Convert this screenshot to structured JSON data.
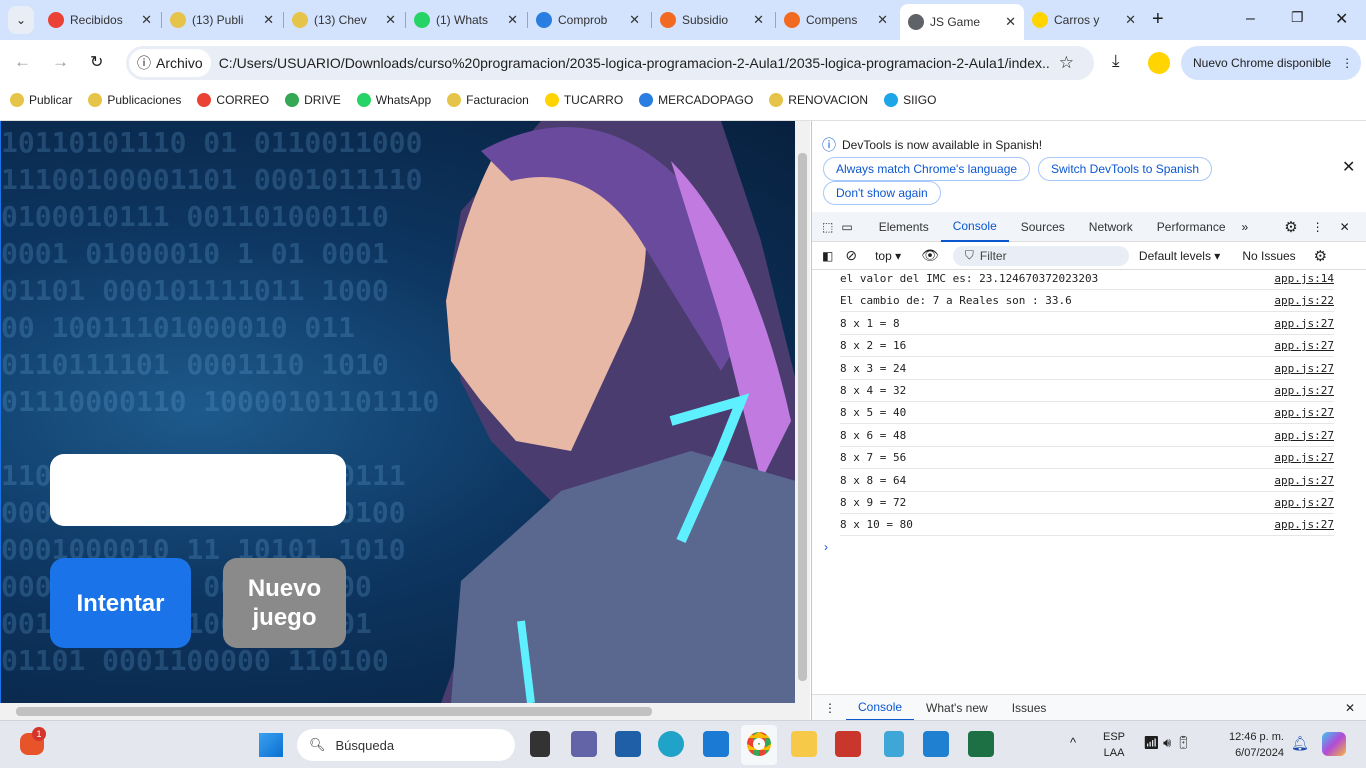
{
  "tabs": [
    {
      "label": "Recibidos",
      "color": "#ea4335"
    },
    {
      "label": "(13) Publi",
      "color": "#e6c44a"
    },
    {
      "label": "(13) Chev",
      "color": "#e6c44a"
    },
    {
      "label": "(1) Whats",
      "color": "#25d366"
    },
    {
      "label": "Comprob",
      "color": "#2a7de1"
    },
    {
      "label": "Subsidio",
      "color": "#f26a21"
    },
    {
      "label": "Compens",
      "color": "#f26a21"
    },
    {
      "label": "JS Game",
      "color": "#5f6368"
    },
    {
      "label": "Carros y",
      "color": "#ffd400"
    }
  ],
  "active_tab": 7,
  "address": {
    "chip": "Archivo",
    "url": "C:/Users/USUARIO/Downloads/curso%20programacion/2035-logica-programacion-2-Aula1/2035-logica-programacion-2-Aula1/index..."
  },
  "update_button": "Nuevo Chrome disponible",
  "bookmarks": [
    {
      "label": "Publicar",
      "color": "#e6c44a"
    },
    {
      "label": "Publicaciones",
      "color": "#e6c44a"
    },
    {
      "label": "CORREO",
      "color": "#ea4335"
    },
    {
      "label": "DRIVE",
      "color": "#34a853"
    },
    {
      "label": "WhatsApp",
      "color": "#25d366"
    },
    {
      "label": "Facturacion",
      "color": "#e6c44a"
    },
    {
      "label": "TUCARRO",
      "color": "#ffd400"
    },
    {
      "label": "MERCADOPAGO",
      "color": "#2a7de1"
    },
    {
      "label": "RENOVACION",
      "color": "#e6c44a"
    },
    {
      "label": "SIIGO",
      "color": "#1ea5e8"
    }
  ],
  "game": {
    "input_value": "",
    "try_button": "Intentar",
    "new_game_button": "Nuevo juego",
    "try_color": "#1a73e8",
    "new_color": "#8a8a8a"
  },
  "devtools": {
    "banner": "DevTools is now available in Spanish!",
    "pills": [
      "Always match Chrome's language",
      "Switch DevTools to Spanish",
      "Don't show again"
    ],
    "tabs": [
      "Elements",
      "Console",
      "Sources",
      "Network",
      "Performance"
    ],
    "active_tab": "Console",
    "context": "top",
    "filter_placeholder": "Filter",
    "levels": "Default levels",
    "issues": "No Issues",
    "logs": [
      {
        "msg": "el valor del IMC es: 23.124670372023203",
        "src": "app.js:14"
      },
      {
        "msg": "El cambio de: 7 a Reales son : 33.6",
        "src": "app.js:22"
      },
      {
        "msg": "8 x 1 = 8",
        "src": "app.js:27"
      },
      {
        "msg": "8 x 2 = 16",
        "src": "app.js:27"
      },
      {
        "msg": "8 x 3 = 24",
        "src": "app.js:27"
      },
      {
        "msg": "8 x 4 = 32",
        "src": "app.js:27"
      },
      {
        "msg": "8 x 5 = 40",
        "src": "app.js:27"
      },
      {
        "msg": "8 x 6 = 48",
        "src": "app.js:27"
      },
      {
        "msg": "8 x 7 = 56",
        "src": "app.js:27"
      },
      {
        "msg": "8 x 8 = 64",
        "src": "app.js:27"
      },
      {
        "msg": "8 x 9 = 72",
        "src": "app.js:27"
      },
      {
        "msg": "8 x 10 = 80",
        "src": "app.js:27"
      }
    ],
    "drawer_tabs": [
      "Console",
      "What's new",
      "Issues"
    ]
  },
  "taskbar": {
    "search": "Búsqueda",
    "lang1": "ESP",
    "lang2": "LAA",
    "time": "12:46 p. m.",
    "date": "6/07/2024",
    "badge": "1"
  }
}
